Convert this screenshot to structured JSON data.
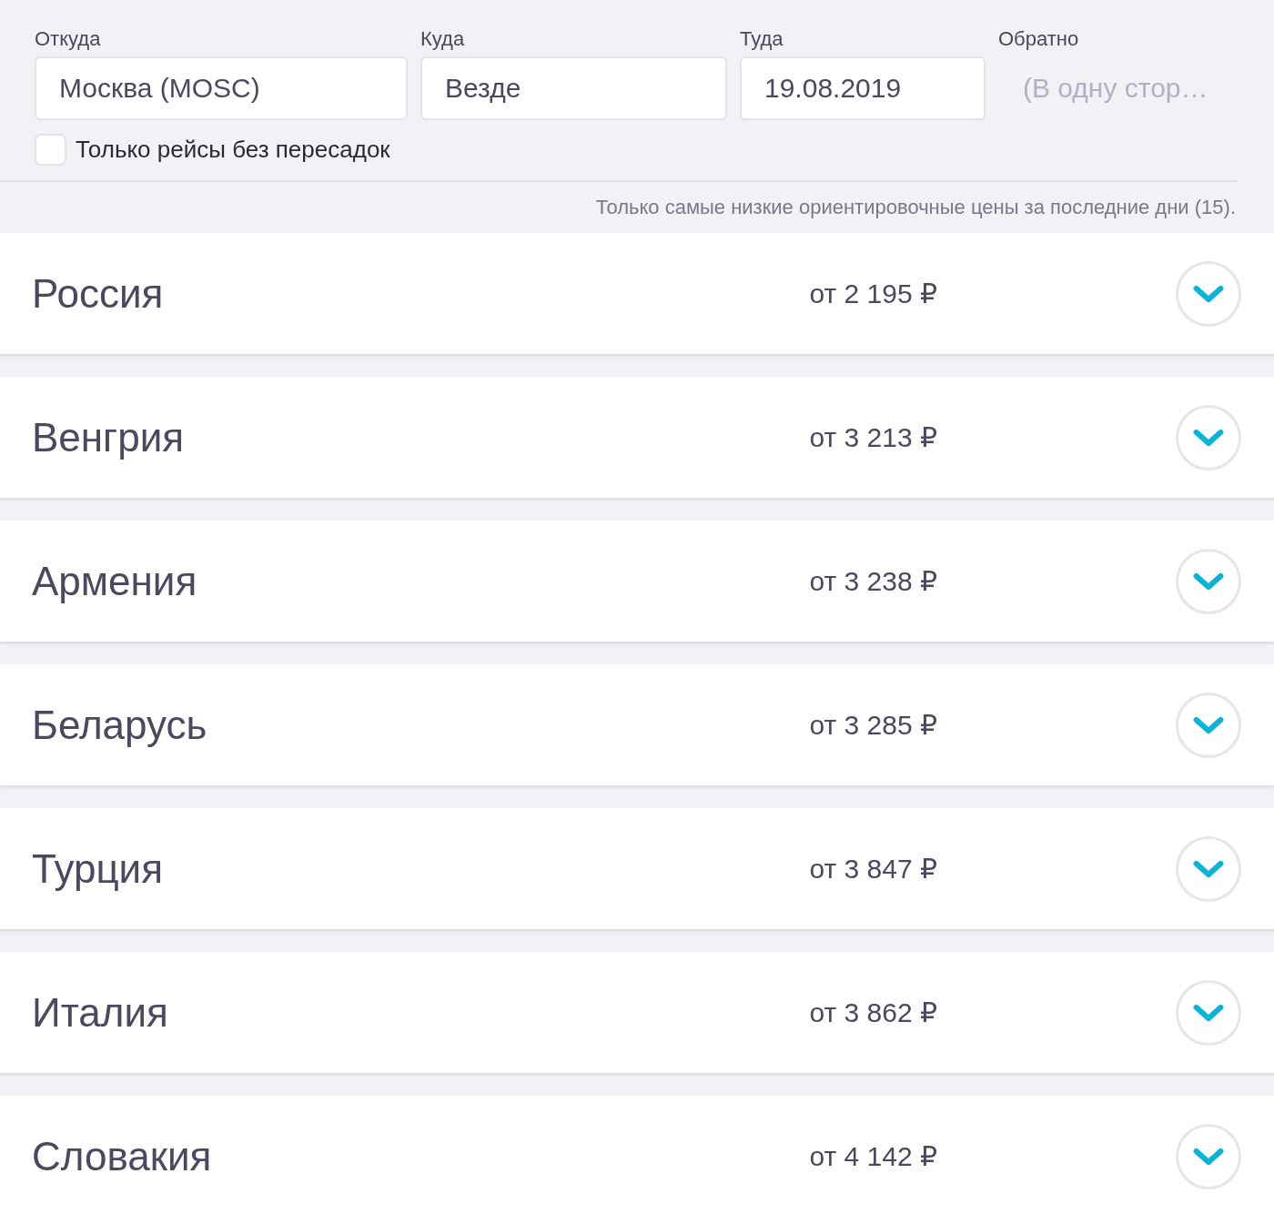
{
  "search_form": {
    "fields": [
      {
        "kind": "input",
        "label": "Откуда",
        "value": "Москва (MOSC)"
      },
      {
        "kind": "input",
        "label": "Куда",
        "value": "Везде"
      },
      {
        "kind": "input",
        "label": "Туда",
        "value": "19.08.2019"
      },
      {
        "kind": "plain",
        "label": "Обратно",
        "placeholder": "(В одну стор…"
      }
    ],
    "nonstop": {
      "label": "Только рейсы без пересадок",
      "checked": false
    },
    "note": "Только самые низкие ориентировочные цены за последние дни (15)."
  },
  "destinations": [
    {
      "country": "Россия",
      "price": "от 2 195 ₽",
      "expanded": false
    },
    {
      "country": "Венгрия",
      "price": "от 3 213 ₽",
      "expanded": false
    },
    {
      "country": "Армения",
      "price": "от 3 238 ₽",
      "expanded": false
    },
    {
      "country": "Беларусь",
      "price": "от 3 285 ₽",
      "expanded": false
    },
    {
      "country": "Турция",
      "price": "от 3 847 ₽",
      "expanded": false
    },
    {
      "country": "Италия",
      "price": "от 3 862 ₽",
      "expanded": false
    },
    {
      "country": "Словакия",
      "price": "от 4 142 ₽",
      "expanded": false
    }
  ]
}
